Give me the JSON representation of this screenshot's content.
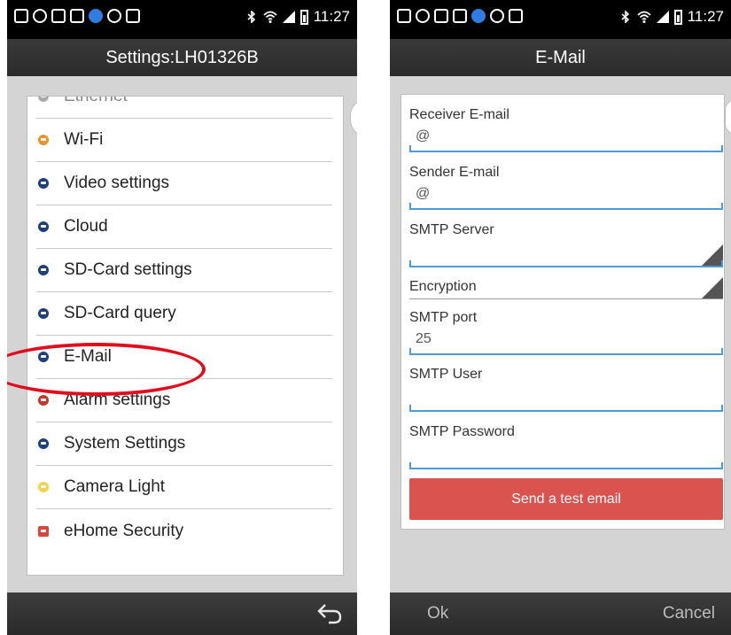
{
  "left_screen": {
    "status_time": "11:27",
    "title": "Settings:LH01326B",
    "items": [
      {
        "label": "Ethernet",
        "color": "#a9a9a9"
      },
      {
        "label": "Wi-Fi",
        "color": "#e6962c"
      },
      {
        "label": "Video settings",
        "color": "#1f3f7a"
      },
      {
        "label": "Cloud",
        "color": "#1f3f7a"
      },
      {
        "label": "SD-Card settings",
        "color": "#1f3f7a"
      },
      {
        "label": "SD-Card query",
        "color": "#1f3f7a"
      },
      {
        "label": "E-Mail",
        "color": "#1f3f7a"
      },
      {
        "label": "Alarm settings",
        "color": "#c0392b"
      },
      {
        "label": "System Settings",
        "color": "#1f3f7a"
      },
      {
        "label": "Camera Light",
        "color": "#f1d24a"
      },
      {
        "label": "eHome Security",
        "color": "#d9463c"
      }
    ],
    "side_tab_icon": "chevron-left-icon",
    "back_icon": "back-arrow-icon"
  },
  "right_screen": {
    "status_time": "11:27",
    "title": "E-Mail",
    "fields": {
      "receiver_email": {
        "label": "Receiver E-mail",
        "value": "@"
      },
      "sender_email": {
        "label": "Sender E-mail",
        "value": "@"
      },
      "smtp_server": {
        "label": "SMTP Server",
        "value": ""
      },
      "encryption": {
        "label": "Encryption",
        "value": ""
      },
      "smtp_port": {
        "label": "SMTP port",
        "value": "25"
      },
      "smtp_user": {
        "label": "SMTP User",
        "value": ""
      },
      "smtp_password": {
        "label": "SMTP Password",
        "value": ""
      }
    },
    "test_button": "Send a test email",
    "ok_button": "Ok",
    "cancel_button": "Cancel"
  },
  "colors": {
    "highlight_oval": "#e10d1c",
    "test_button": "#d9534f",
    "input_underline": "#4c9ad6"
  }
}
